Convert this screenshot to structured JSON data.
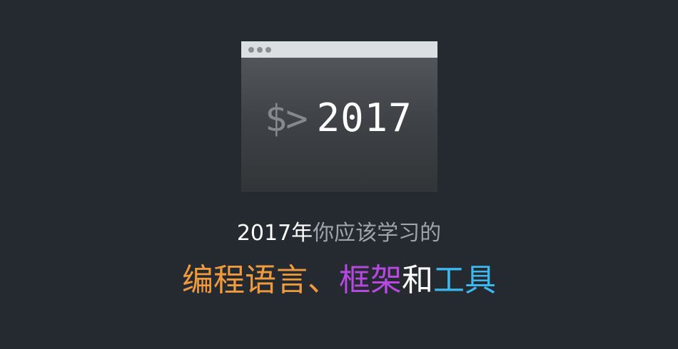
{
  "terminal": {
    "prompt": "$>",
    "year": "2017"
  },
  "headline": {
    "year_part": "2017年",
    "rest_part": "你应该学习的"
  },
  "subheadline": {
    "part1": "编程语言、",
    "part2": "框架",
    "part3": "和",
    "part4": "工具"
  },
  "colors": {
    "background": "#252a31",
    "orange": "#f09a3e",
    "purple": "#b748e0",
    "blue": "#3db8ef"
  },
  "icons": [
    "terminal-window-icon"
  ]
}
